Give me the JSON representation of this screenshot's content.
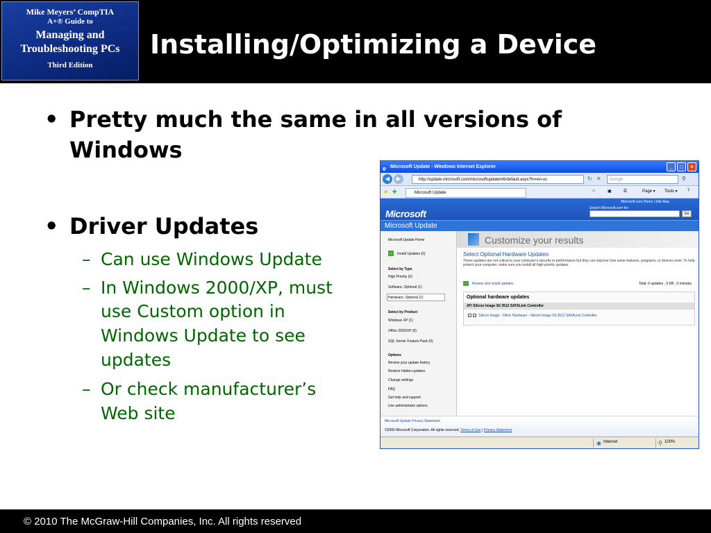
{
  "logo": {
    "line1": "Mike Meyers’ CompTIA",
    "line2": "A+® Guide to",
    "line3": "Managing and",
    "line4": "Troubleshooting PCs",
    "line5": "Third Edition"
  },
  "slide": {
    "title": "Installing/Optimizing a Device",
    "bullets": [
      {
        "text_lines": [
          "Pretty much the same in all versions of",
          "Windows"
        ]
      },
      {
        "text_lines": [
          "Driver Updates"
        ],
        "subs": [
          {
            "lines": [
              "Can use Windows Update"
            ]
          },
          {
            "lines": [
              "In Windows 2000/XP, must",
              "use Custom option in",
              "Windows Update to see",
              "updates"
            ]
          },
          {
            "lines": [
              "Or check manufacturer’s",
              "Web site"
            ]
          }
        ]
      }
    ],
    "bullet_glyph": "•",
    "sub_glyph": "–"
  },
  "footer": {
    "copyright": "© 2010 The McGraw-Hill Companies, Inc. All rights reserved"
  },
  "ie": {
    "title": "Microsoft Update - Windows Internet Explorer",
    "address": "http://update.microsoft.com/microsoftupdate/v6/default.aspx?ln=en-us",
    "search_placeholder": "Google",
    "tab_label": "Microsoft Update",
    "commands": {
      "page": "Page ▾",
      "tools": "Tools ▾"
    },
    "top_links": "Microsoft.com Home  |  Site Map",
    "ms_logo": "Microsoft",
    "search_label": "Search Microsoft.com for:",
    "go": "Go",
    "mu_title": "Microsoft Update",
    "nav": {
      "home": "Microsoft Update Home",
      "install": "Install Updates  (0)",
      "select_type": "Select by Type",
      "high_priority": "High Priority (0)",
      "software_optional": "Software, Optional (1)",
      "hardware_optional": "Hardware, Optional (1)",
      "select_product": "Select by Product",
      "windows_xp": "Windows XP (1)",
      "office": "Office 2002/XP (0)",
      "sql": "SQL Server Feature Pack (0)",
      "options": "Options",
      "history": "Review your update history",
      "restore": "Restore hidden updates",
      "settings": "Change settings",
      "faq": "FAQ",
      "help": "Get help and support",
      "admin": "Use administrator options"
    },
    "main": {
      "customize": "Customize your results",
      "section_title": "Select Optional Hardware Updates",
      "section_desc": "These updates are not critical to your computer's security or performance but they can improve how some features, programs, or devices work. To help protect your computer, make sure you install all high-priority updates.",
      "review_link": "Review and install updates",
      "total": "Total:  0 updates , 0 KB , 0 minutes",
      "box_title": "Optional hardware updates",
      "box_row": "ATI Silicon Image SiI 3512 SATALink Controller",
      "box_item": "Silicon Image - Other Hardware - Silicon Image SiI 3512 SATALink Controller"
    },
    "privacy_link": "Microsoft Update Privacy Statement",
    "copyright_prefix": "©2006 Microsoft Corporation. All rights reserved.",
    "terms_link": "Terms of Use",
    "privacy_small": "Privacy Statement",
    "status_zone": "Internet",
    "status_zoom": "100%"
  }
}
